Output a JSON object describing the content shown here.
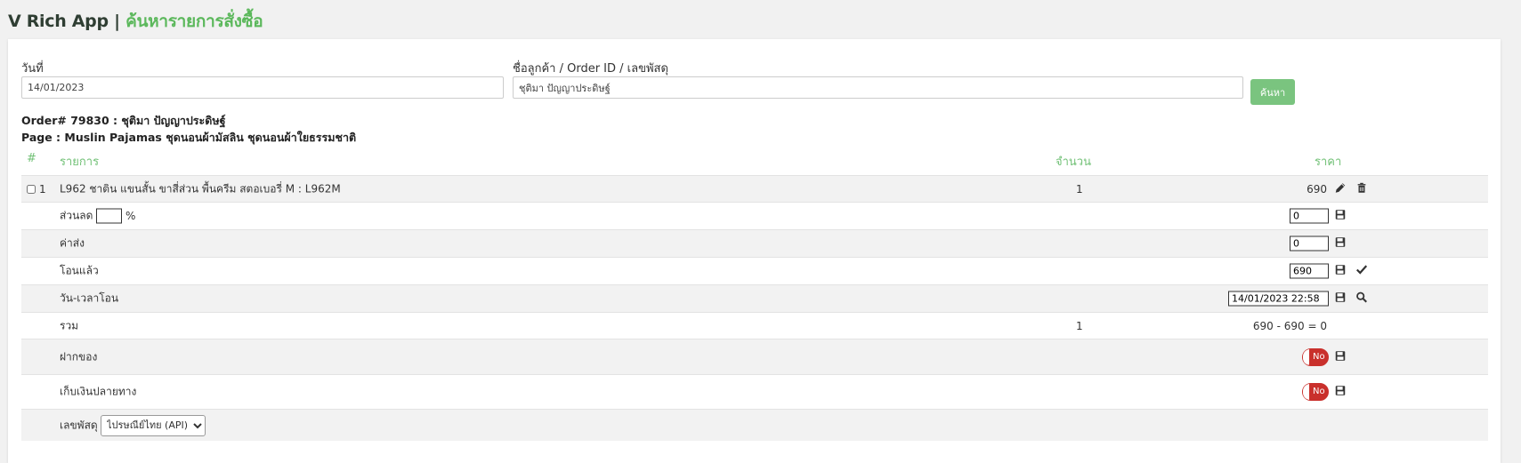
{
  "header": {
    "app_name": "V Rich App",
    "separator": "|",
    "page_title": "ค้นหารายการสั่งซื้อ"
  },
  "search": {
    "date_label": "วันที่",
    "date_value": "14/01/2023",
    "query_label": "ชื่อลูกค้า / Order ID / เลขพัสดุ",
    "query_value": "ชุติมา ปัญญาประดิษฐ์",
    "button_label": "ค้นหา"
  },
  "order": {
    "title": "Order# 79830 : ชุติมา ปัญญาประดิษฐ์",
    "page": "Page : Muslin Pajamas ชุดนอนผ้ามัสลิน ชุดนอนผ้าใยธรรมชาติ"
  },
  "table": {
    "columns": {
      "no": "#",
      "item": "รายการ",
      "qty": "จำนวน",
      "price": "ราคา"
    },
    "items": [
      {
        "no": "1",
        "name": "L962 ชาติน แขนสั้น ขาสี่ส่วน พื้นครีม สตอเบอรี่ M : L962M",
        "qty": "1",
        "price": "690"
      }
    ],
    "discount": {
      "label": "ส่วนลด",
      "percent_value": "",
      "percent_suffix": "%",
      "amount": "0"
    },
    "shipping": {
      "label": "ค่าส่ง",
      "amount": "0"
    },
    "paid": {
      "label": "โอนแล้ว",
      "amount": "690"
    },
    "transfer_time": {
      "label": "วัน-เวลาโอน",
      "value": "14/01/2023 22:58"
    },
    "total": {
      "label": "รวม",
      "qty": "1",
      "calc": "690 - 690 = 0"
    },
    "deposit": {
      "label": "ฝากของ",
      "toggle": "No"
    },
    "cod": {
      "label": "เก็บเงินปลายทาง",
      "toggle": "No"
    },
    "tracking": {
      "label": "เลขพัสดุ",
      "carrier_selected": "ไปรษณีย์ไทย (API)"
    }
  },
  "colors": {
    "accent": "#5cb85c",
    "button": "#7ac47f",
    "toggle_off": "#c9302c"
  },
  "icons": [
    "pencil-icon",
    "trash-icon",
    "save-icon",
    "check-icon",
    "search-icon",
    "dropdown-chevron-icon"
  ]
}
